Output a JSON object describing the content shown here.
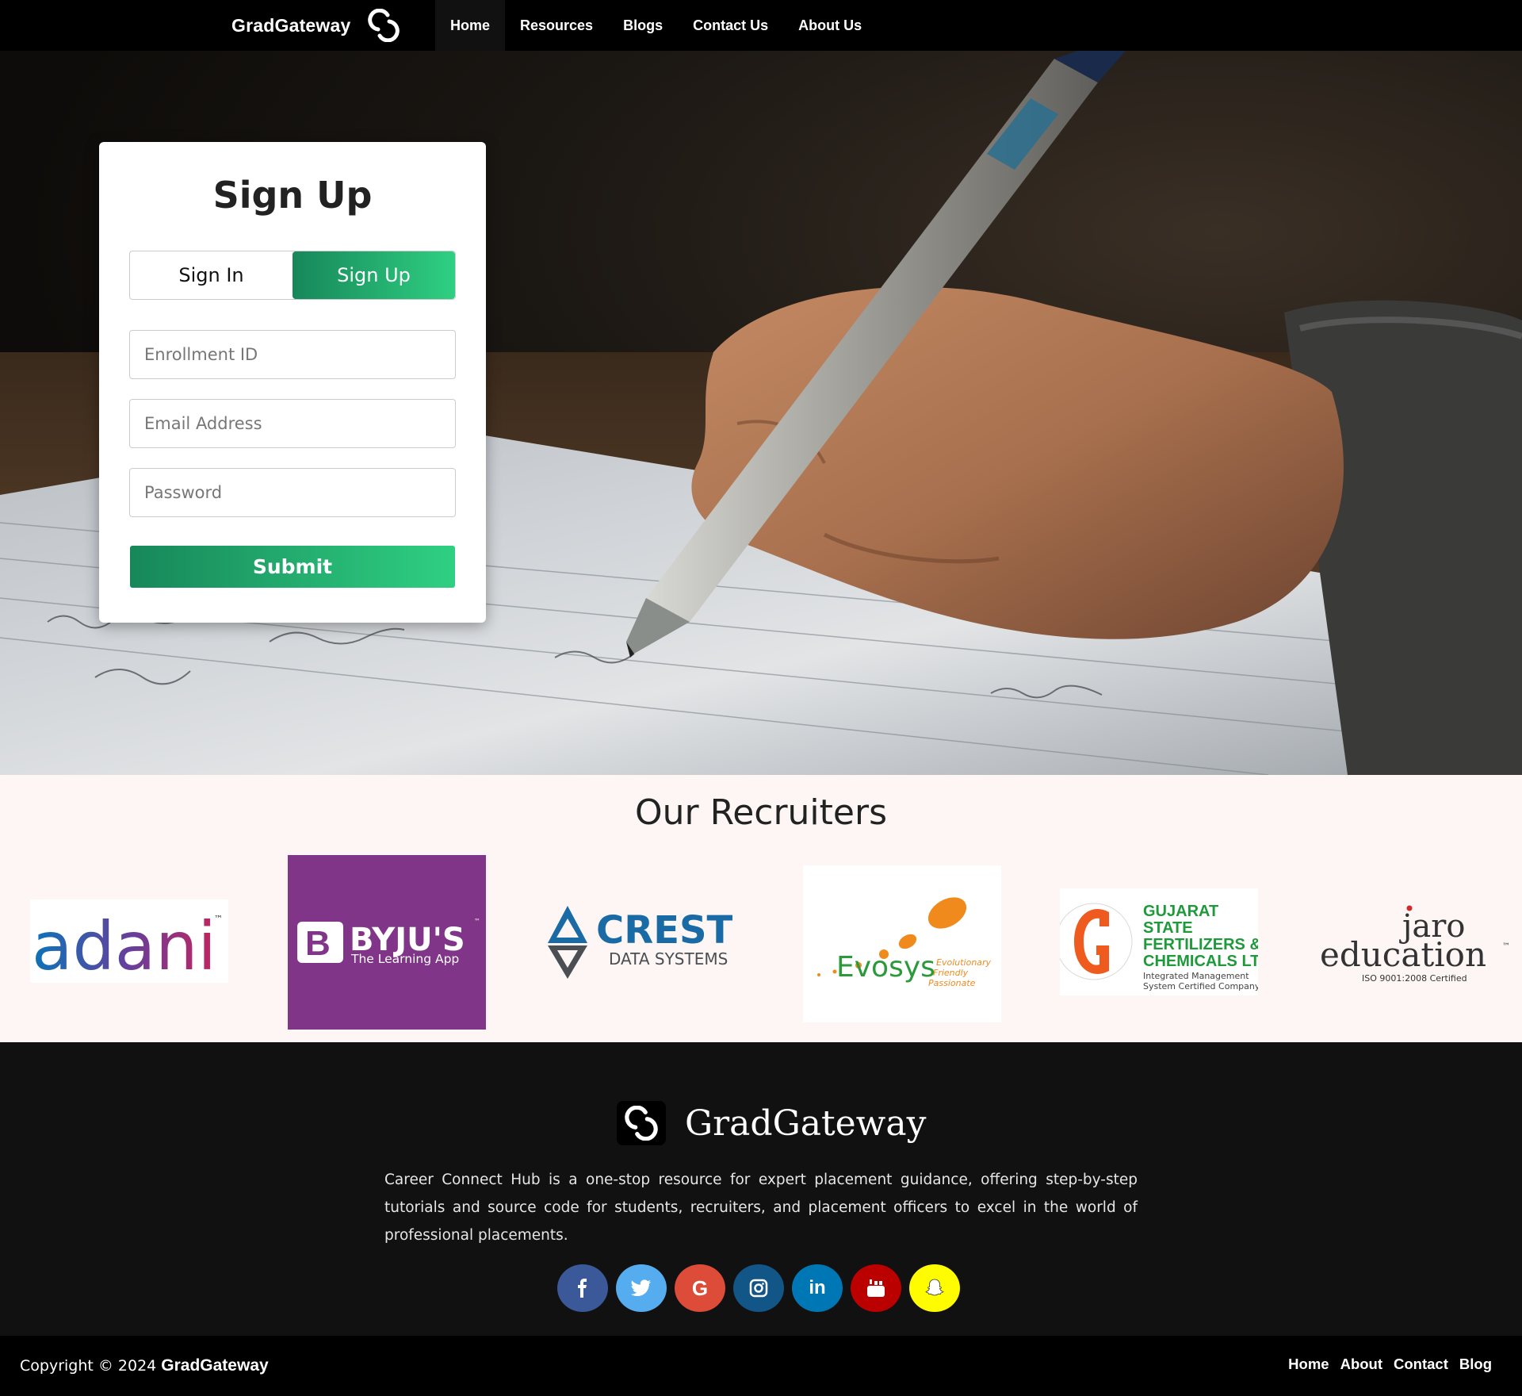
{
  "navbar": {
    "brand": "GradGateway",
    "links": [
      "Home",
      "Resources",
      "Blogs",
      "Contact Us",
      "About Us"
    ],
    "active": "Home"
  },
  "signup": {
    "title": "Sign Up",
    "tabs": [
      "Sign In",
      "Sign Up"
    ],
    "active_tab": "Sign Up",
    "fields": {
      "enrollment_placeholder": "Enrollment ID",
      "email_placeholder": "Email Address",
      "password_placeholder": "Password"
    },
    "submit_label": "Submit"
  },
  "recruiters": {
    "title": "Our Recruiters",
    "logos": [
      {
        "name": "adani",
        "mark": "™"
      },
      {
        "name": "BYJU'S",
        "tagline": "The Learning App",
        "mark": "™"
      },
      {
        "name": "CREST",
        "tagline": "DATA SYSTEMS"
      },
      {
        "name": "Evosys",
        "tagline_lines": [
          "Evolutionary",
          "Friendly",
          "Passionate"
        ]
      },
      {
        "name_lines": [
          "GUJARAT",
          "STATE",
          "FERTILIZERS &",
          "CHEMICALS LTD."
        ],
        "tagline_lines": [
          "Integrated Management",
          "System Certified Company"
        ]
      },
      {
        "name_lines": [
          "jaro",
          "education"
        ],
        "tagline": "ISO 9001:2008 Certified",
        "mark": "™"
      }
    ]
  },
  "footer": {
    "brand": "GradGateway",
    "description": "Career Connect Hub is a one-stop resource for expert placement guidance, offering step-by-step tutorials and source code for students, recruiters, and placement officers to excel in the world of professional placements.",
    "socials": [
      {
        "icon": "facebook-icon",
        "color": "#3b5998"
      },
      {
        "icon": "twitter-icon",
        "color": "#55acee"
      },
      {
        "icon": "google-icon",
        "color": "#dd4b39"
      },
      {
        "icon": "instagram-icon",
        "color": "#125688"
      },
      {
        "icon": "linkedin-icon",
        "color": "#0077b5"
      },
      {
        "icon": "youtube-icon",
        "color": "#bb0000"
      },
      {
        "icon": "snapchat-icon",
        "color": "#fffc00"
      }
    ],
    "copyright_prefix": "Copyright © 2024",
    "copyright_brand": "GradGateway",
    "links": [
      "Home",
      "About",
      "Contact",
      "Blog"
    ]
  },
  "colors": {
    "accent_start": "#17875a",
    "accent_end": "#2fd082",
    "navbar_bg": "#000000",
    "recruiters_bg": "#fdf6f5",
    "footer_bg": "#111111"
  }
}
